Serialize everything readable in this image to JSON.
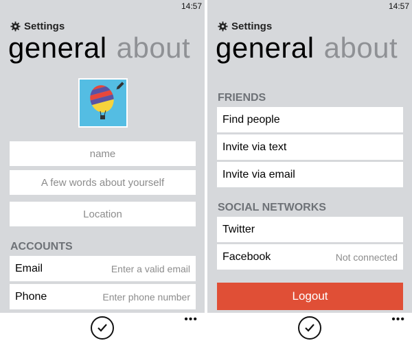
{
  "status": {
    "time": "14:57"
  },
  "app": {
    "title": "Settings"
  },
  "pivot": {
    "items": [
      "general",
      "about"
    ]
  },
  "general": {
    "fields": {
      "name_placeholder": "name",
      "about_placeholder": "A few words about yourself",
      "location_placeholder": "Location"
    },
    "accounts": {
      "header": "ACCOUNTS",
      "rows": [
        {
          "label": "Email",
          "value": "Enter a valid email"
        },
        {
          "label": "Phone",
          "value": "Enter phone number"
        }
      ]
    }
  },
  "about": {
    "friends": {
      "header": "FRIENDS",
      "items": [
        "Find people",
        "Invite via text",
        "Invite via email"
      ]
    },
    "social": {
      "header": "SOCIAL NETWORKS",
      "rows": [
        {
          "label": "Twitter",
          "value": ""
        },
        {
          "label": "Facebook",
          "value": "Not connected"
        }
      ]
    },
    "logout_label": "Logout"
  },
  "appbar": {
    "more": "•••"
  },
  "icons": {
    "settings": "gear-icon",
    "edit": "pencil-icon",
    "avatar": "hot-air-balloon-icon",
    "confirm": "checkmark-icon",
    "more": "ellipsis-icon"
  },
  "colors": {
    "background": "#d6d8db",
    "accent": "#e04f36",
    "avatar_bg": "#54bde3"
  }
}
